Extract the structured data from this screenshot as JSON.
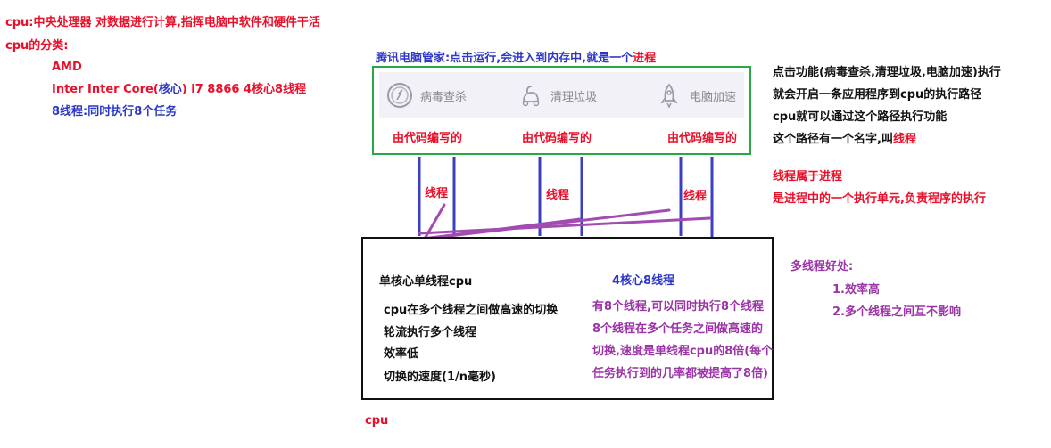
{
  "notes": {
    "line1": "cpu:中央处理器 对数据进行计算,指挥电脑中软件和硬件干活",
    "line2": "cpu的分类:",
    "amd": "AMD",
    "intel_a": "Inter Inter Core(",
    "intel_b": "核心",
    "intel_c": ") i7 8866 4核心8线程",
    "eight_threads": "8线程:同时执行8个任务"
  },
  "app": {
    "caption_a": "腾讯电脑管家:点击运行,会进入到内存中,就是一个",
    "caption_b": "进程",
    "tools": [
      {
        "label": "病毒查杀",
        "icon": "shield-icon"
      },
      {
        "label": "清理垃圾",
        "icon": "broom-icon"
      },
      {
        "label": "电脑加速",
        "icon": "rocket-icon"
      }
    ],
    "coded_by": "由代码编写的",
    "thread": "线程"
  },
  "right_notes": {
    "p1": "点击功能(病毒查杀,清理垃圾,电脑加速)执行",
    "p2": "就会开启一条应用程序到cpu的执行路径",
    "p3": "cpu就可以通过这个路径执行功能",
    "p4a": "这个路径有一个名字,叫",
    "p4b": "线程",
    "p5": "线程属于进程",
    "p6": "是进程中的一个执行单元,负责程序的执行"
  },
  "cpu": {
    "single_title": "单核心单线程cpu",
    "single_lines": [
      "cpu在多个线程之间做高速的切换",
      "轮流执行多个线程",
      "效率低",
      "切换的速度(1/n毫秒)"
    ],
    "multi_title": "4核心8线程",
    "multi_lines": [
      "有8个线程,可以同时执行8个线程",
      "8个线程在多个任务之间做高速的",
      "切换,速度是单线程cpu的8倍(每个",
      "任务执行到的几率都被提高了8倍)"
    ],
    "label": "cpu"
  },
  "benefits": {
    "title": "多线程好处:",
    "items": [
      "1.效率高",
      "2.多个线程之间互不影响"
    ]
  },
  "colors": {
    "red": "#e8102a",
    "blue": "#2c37c7",
    "purple": "#9b34a6",
    "green": "#2aa845"
  }
}
